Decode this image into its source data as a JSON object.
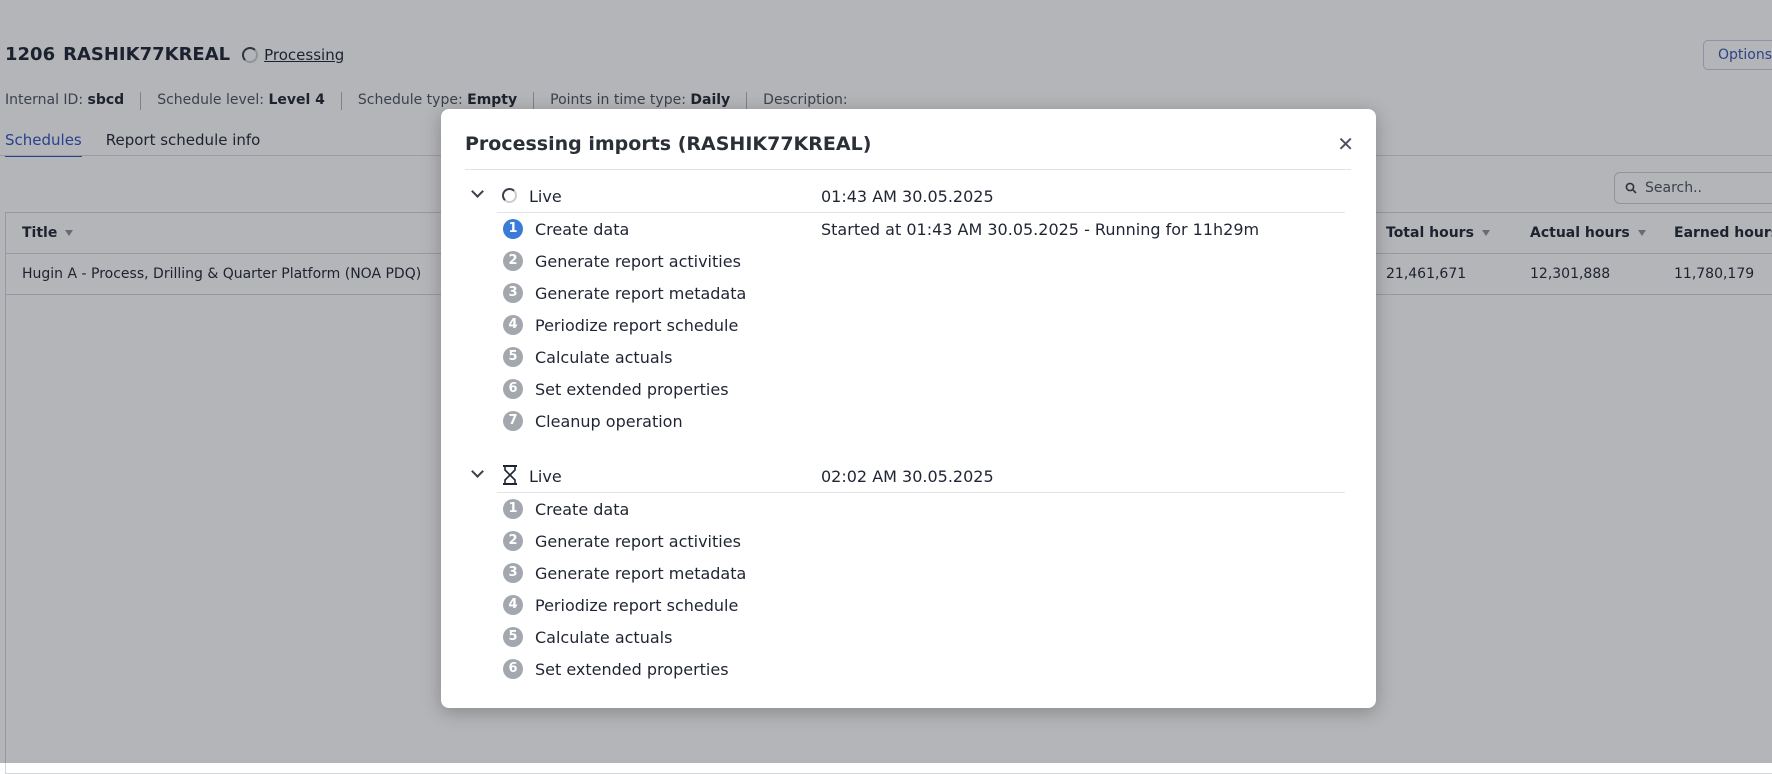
{
  "header": {
    "id": "1206",
    "name": "RASHIK77KREAL",
    "status": "Processing",
    "options_label": "Options"
  },
  "meta": [
    {
      "label": "Internal ID:",
      "value": "sbcd"
    },
    {
      "label": "Schedule level:",
      "value": "Level 4"
    },
    {
      "label": "Schedule type:",
      "value": "Empty"
    },
    {
      "label": "Points in time type:",
      "value": "Daily"
    },
    {
      "label": "Description:",
      "value": ""
    }
  ],
  "tabs": [
    {
      "label": "Schedules",
      "active": true
    },
    {
      "label": "Report schedule info",
      "active": false
    }
  ],
  "search": {
    "placeholder": "Search.."
  },
  "table": {
    "columns": [
      "Title",
      "Total hours",
      "Actual hours",
      "Earned hours"
    ],
    "rows": [
      {
        "title": "Hugin A - Process, Drilling & Quarter Platform (NOA PDQ)",
        "total_hours": "21,461,671",
        "actual_hours": "12,301,888",
        "earned_hours": "11,780,179"
      }
    ]
  },
  "modal": {
    "title": "Processing imports (RASHIK77KREAL)",
    "groups": [
      {
        "label": "Live",
        "time": "01:43 AM 30.05.2025",
        "icon": "spinner-icon",
        "steps": [
          {
            "num": "1",
            "label": "Create data",
            "detail": "Started at 01:43 AM 30.05.2025 - Running for 11h29m",
            "active": true
          },
          {
            "num": "2",
            "label": "Generate report activities"
          },
          {
            "num": "3",
            "label": "Generate report metadata"
          },
          {
            "num": "4",
            "label": "Periodize report schedule"
          },
          {
            "num": "5",
            "label": "Calculate actuals"
          },
          {
            "num": "6",
            "label": "Set extended properties"
          },
          {
            "num": "7",
            "label": "Cleanup operation"
          }
        ]
      },
      {
        "label": "Live",
        "time": "02:02 AM 30.05.2025",
        "icon": "hourglass-icon",
        "steps": [
          {
            "num": "1",
            "label": "Create data"
          },
          {
            "num": "2",
            "label": "Generate report activities"
          },
          {
            "num": "3",
            "label": "Generate report metadata"
          },
          {
            "num": "4",
            "label": "Periodize report schedule"
          },
          {
            "num": "5",
            "label": "Calculate actuals"
          },
          {
            "num": "6",
            "label": "Set extended properties"
          }
        ]
      }
    ]
  },
  "colors": {
    "accent": "#2f52c4",
    "active_step": "#3a7bd8",
    "inactive_step": "#a3a7ae"
  }
}
